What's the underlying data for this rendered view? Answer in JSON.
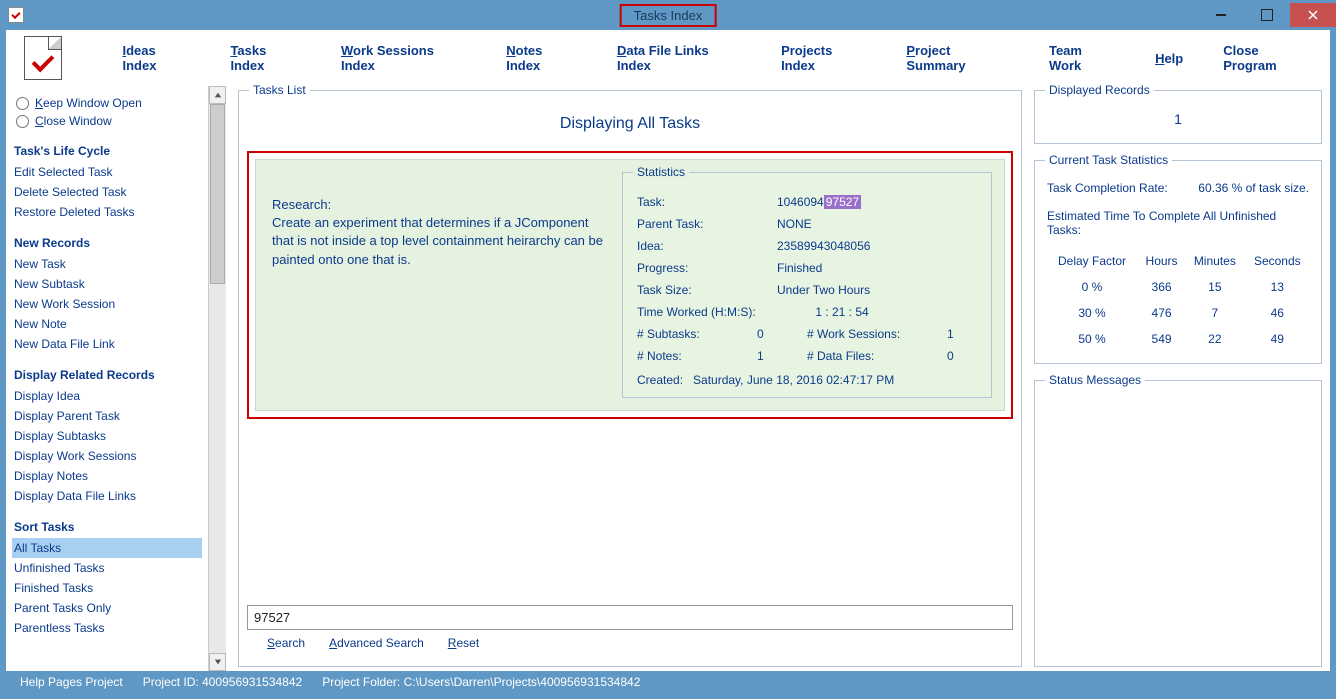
{
  "window": {
    "title": "Tasks Index"
  },
  "menu": {
    "ideas": "Ideas Index",
    "tasks": "Tasks Index",
    "work": "Work Sessions Index",
    "notes": "Notes Index",
    "data": "Data File Links Index",
    "projects": "Projects Index",
    "summary": "Project Summary",
    "team": "Team Work",
    "help": "Help",
    "close": "Close Program"
  },
  "sidebar": {
    "keep_open": "Keep Window Open",
    "close_window": "Close Window",
    "life_cycle_head": "Task's Life Cycle",
    "edit_task": "Edit Selected Task",
    "delete_task": "Delete Selected Task",
    "restore_task": "Restore Deleted Tasks",
    "new_records_head": "New Records",
    "new_task": "New Task",
    "new_subtask": "New Subtask",
    "new_work": "New Work Session",
    "new_note": "New Note",
    "new_data": "New Data File Link",
    "display_head": "Display Related Records",
    "disp_idea": "Display Idea",
    "disp_parent": "Display Parent Task",
    "disp_sub": "Display Subtasks",
    "disp_work": "Display Work Sessions",
    "disp_notes": "Display Notes",
    "disp_data": "Display Data File Links",
    "sort_head": "Sort Tasks",
    "all_tasks": "All Tasks",
    "unfinished": "Unfinished Tasks",
    "finished": "Finished Tasks",
    "parent_only": "Parent Tasks Only",
    "parentless": "Parentless Tasks"
  },
  "tasks": {
    "list_legend": "Tasks List",
    "list_title": "Displaying All Tasks",
    "desc_title": "Research:",
    "desc_body": "Create an experiment that determines if a JComponent that is not inside a top level containment heirarchy can be painted onto one that is.",
    "stats_legend": "Statistics",
    "task_label": "Task:",
    "task_val_pre": "1046094",
    "task_val_hl": "97527",
    "parent_label": "Parent Task:",
    "parent_val": "NONE",
    "idea_label": "Idea:",
    "idea_val": "23589943048056",
    "progress_label": "Progress:",
    "progress_val": "Finished",
    "size_label": "Task Size:",
    "size_val": "Under Two Hours",
    "worked_label": "Time Worked (H:M:S):",
    "worked_val": "1 : 21 : 54",
    "sub_label": "# Subtasks:",
    "sub_val": "0",
    "ws_label": "# Work Sessions:",
    "ws_val": "1",
    "notes_label": "# Notes:",
    "notes_val": "1",
    "df_label": "# Data Files:",
    "df_val": "0",
    "created_label": "Created:",
    "created_val": "Saturday, June 18, 2016   02:47:17 PM"
  },
  "search": {
    "value": "97527",
    "search": "Search",
    "advanced": "Advanced Search",
    "reset": "Reset"
  },
  "displayed": {
    "legend": "Displayed Records",
    "count": "1"
  },
  "rstats": {
    "legend": "Current Task Statistics",
    "rate_label": "Task Completion Rate:",
    "rate_val": "60.36 % of task size.",
    "est_label": "Estimated Time To Complete All Unfinished Tasks:",
    "headers": {
      "delay": "Delay Factor",
      "hours": "Hours",
      "minutes": "Minutes",
      "seconds": "Seconds"
    },
    "rows": [
      {
        "delay": "0 %",
        "h": "366",
        "m": "15",
        "s": "13"
      },
      {
        "delay": "30 %",
        "h": "476",
        "m": "7",
        "s": "46"
      },
      {
        "delay": "50 %",
        "h": "549",
        "m": "22",
        "s": "49"
      }
    ]
  },
  "status_legend": "Status Messages",
  "footer": {
    "help": "Help Pages Project",
    "pid": "Project ID: 400956931534842",
    "folder": "Project Folder: C:\\Users\\Darren\\Projects\\400956931534842"
  }
}
